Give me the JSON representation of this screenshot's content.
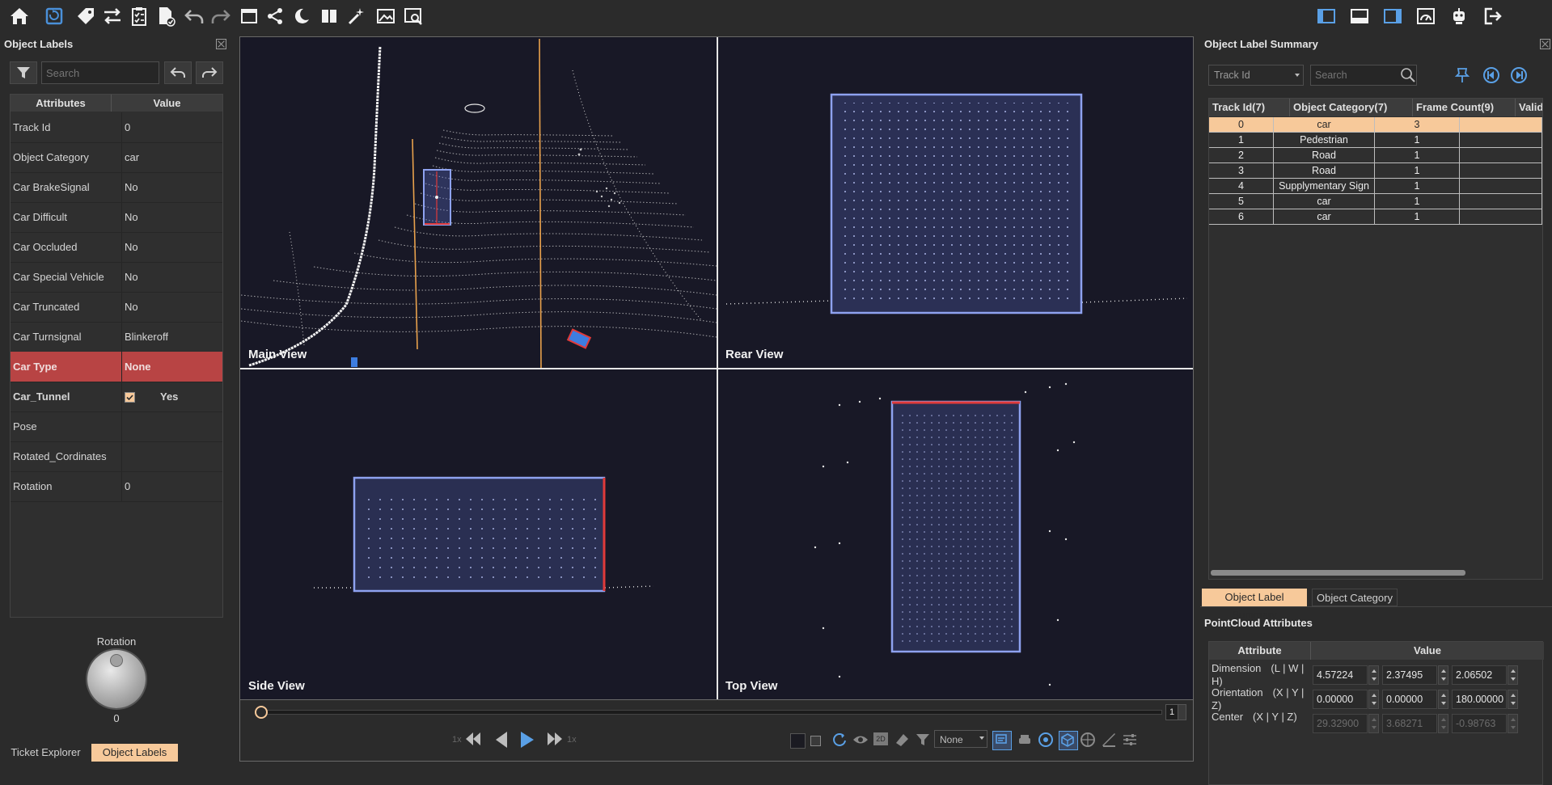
{
  "toolbar": {
    "icons": [
      "home-icon",
      "save-icon",
      "tag-icon",
      "swap-icon",
      "checklist-icon",
      "file-check-icon",
      "undo-icon",
      "redo-icon",
      "window-icon",
      "share-icon",
      "moon-icon",
      "split-view-icon",
      "magic-wand-icon",
      "image-edit-icon",
      "image-search-icon"
    ],
    "right_icons": [
      "left-panel-icon",
      "bottom-panel-icon",
      "right-panel-icon",
      "dashboard-icon",
      "robot-icon",
      "logout-icon"
    ]
  },
  "left_panel": {
    "title": "Object Labels",
    "search_placeholder": "Search",
    "columns": [
      "Attributes",
      "Value"
    ],
    "rows": [
      {
        "attr": "Track Id",
        "value": "0"
      },
      {
        "attr": "Object Category",
        "value": "car"
      },
      {
        "attr": "Car BrakeSignal",
        "value": "No"
      },
      {
        "attr": "Car Difficult",
        "value": "No"
      },
      {
        "attr": "Car Occluded",
        "value": "No"
      },
      {
        "attr": "Car Special Vehicle",
        "value": "No"
      },
      {
        "attr": "Car Truncated",
        "value": "No"
      },
      {
        "attr": "Car Turnsignal",
        "value": "Blinkeroff"
      },
      {
        "attr": "Car Type",
        "value": "None"
      },
      {
        "attr": "Car_Tunnel",
        "value": "Yes"
      },
      {
        "attr": "Pose",
        "value": ""
      },
      {
        "attr": "Rotated_Cordinates",
        "value": ""
      },
      {
        "attr": "Rotation",
        "value": "0"
      }
    ],
    "dial_label": "Rotation",
    "dial_value": "0",
    "tabs": [
      "Ticket Explorer",
      "Object Labels"
    ]
  },
  "views": {
    "main": "Main View",
    "rear": "Rear View",
    "side": "Side View",
    "top": "Top View"
  },
  "playback": {
    "frame": "1",
    "speed_left": "1x",
    "speed_right": "1x",
    "dropdown": "None"
  },
  "right_panel": {
    "title": "Object Label Summary",
    "filter_select": "Track Id",
    "search_placeholder": "Search",
    "columns": [
      "Track Id(7)",
      "Object Category(7)",
      "Frame Count(9)",
      "Valid"
    ],
    "rows": [
      {
        "id": "0",
        "category": "car",
        "count": "3"
      },
      {
        "id": "1",
        "category": "Pedestrian",
        "count": "1"
      },
      {
        "id": "2",
        "category": "Road",
        "count": "1"
      },
      {
        "id": "3",
        "category": "Road",
        "count": "1"
      },
      {
        "id": "4",
        "category": "Supplymentary Sign",
        "count": "1"
      },
      {
        "id": "5",
        "category": "car",
        "count": "1"
      },
      {
        "id": "6",
        "category": "car",
        "count": "1"
      }
    ],
    "tabs": [
      "Object Label Summary",
      "Object Category"
    ],
    "pc_title": "PointCloud Attributes",
    "pc_columns": [
      "Attribute",
      "Value"
    ],
    "pc_rows": [
      {
        "name": "Dimension",
        "axes": "(L | W | H)",
        "v1": "4.57224",
        "v2": "2.37495",
        "v3": "2.06502"
      },
      {
        "name": "Orientation",
        "axes": "(X | Y | Z)",
        "v1": "0.00000",
        "v2": "0.00000",
        "v3": "180.00000"
      },
      {
        "name": "Center",
        "axes": "(X | Y | Z)",
        "v1": "29.32900",
        "v2": "3.68271",
        "v3": "-0.98763"
      }
    ]
  },
  "colors": {
    "accent_orange": "#f7c99a",
    "selected_red": "#b84444",
    "box_blue": "#8ea2f0",
    "edge_red": "#e03a3a"
  }
}
